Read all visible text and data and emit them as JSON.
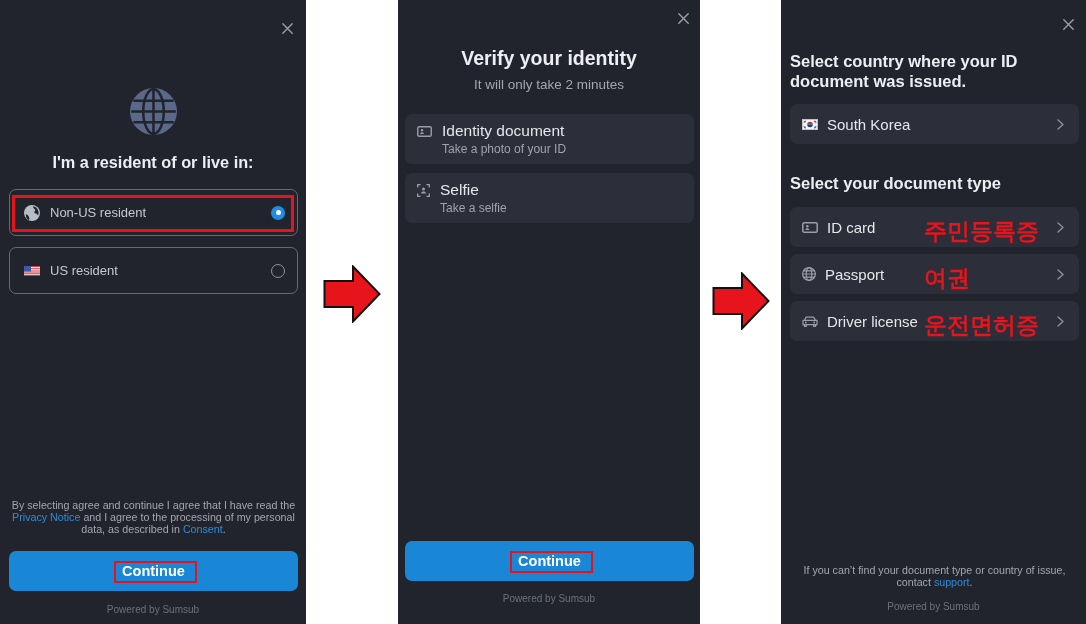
{
  "screens": [
    {
      "kind": "residence",
      "heading": "I'm a resident of or live in:",
      "options": [
        {
          "label": "Non-US resident",
          "selected": true,
          "highlighted": true
        },
        {
          "label": "US resident",
          "selected": false,
          "highlighted": false
        }
      ],
      "consent": [
        {
          "kind": "text",
          "text": "By selecting agree and continue I agree that I have read the "
        },
        {
          "kind": "link",
          "text": "Privacy Notice"
        },
        {
          "kind": "text",
          "text": " and I agree to the processing of my personal data, as described in "
        },
        {
          "kind": "link",
          "text": "Consent"
        },
        {
          "kind": "text",
          "text": "."
        }
      ],
      "button": {
        "label": "Continue",
        "highlighted": true
      },
      "footer": "Powered by Sumsub"
    },
    {
      "kind": "steps",
      "heading": "Verify your identity",
      "subheading": "It will only take 2 minutes",
      "steps": [
        {
          "title": "Identity document",
          "subtitle": "Take a photo of your ID"
        },
        {
          "title": "Selfie",
          "subtitle": "Take a selfie"
        }
      ],
      "button": {
        "label": "Continue",
        "highlighted": true
      },
      "footer": "Powered by Sumsub"
    },
    {
      "kind": "document",
      "country_heading": "Select country where your ID document was issued.",
      "country": "South Korea",
      "type_heading": "Select your document type",
      "document_types": [
        {
          "label": "ID card",
          "annotation": "주민등록증"
        },
        {
          "label": "Passport",
          "annotation": "여권"
        },
        {
          "label": "Driver license",
          "annotation": "운전면허증"
        }
      ],
      "help": [
        {
          "kind": "text",
          "text": "If you can’t find your document type or country of issue, contact "
        },
        {
          "kind": "link",
          "text": "support"
        },
        {
          "kind": "text",
          "text": "."
        }
      ],
      "footer": "Powered by Sumsub"
    }
  ]
}
